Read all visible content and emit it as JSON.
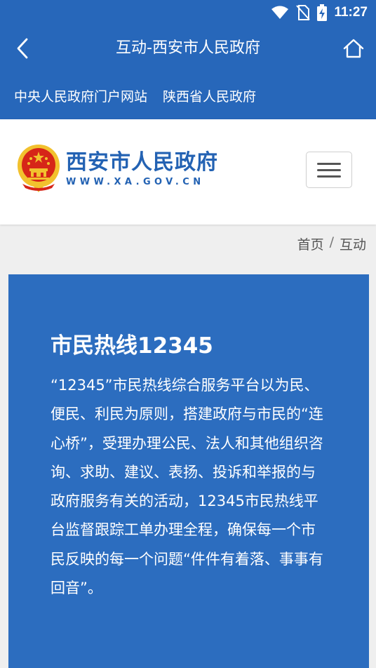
{
  "status_bar": {
    "time": "11:27",
    "icons": [
      "wifi-icon",
      "no-sim-icon",
      "battery-charging-icon"
    ]
  },
  "app_bar": {
    "title": "互动-西安市人民政府",
    "back_icon": "chevron-left-icon",
    "home_icon": "home-icon"
  },
  "top_links": [
    "中央人民政府门户网站",
    "陕西省人民政府"
  ],
  "site_header": {
    "logo_name": "西安市人民政府",
    "logo_url": "WWW.XA.GOV.CN",
    "menu_icon": "hamburger-menu-icon"
  },
  "breadcrumb": {
    "home": "首页",
    "separator": "/",
    "current": "互动"
  },
  "hotline_card": {
    "title": "市民热线12345",
    "body": "“12345”市民热线综合服务平台以为民、便民、利民为原则，搭建政府与市民的“连心桥”，受理办理公民、法人和其他组织咨询、求助、建议、表扬、投诉和举报的与政府服务有关的活动，12345市民热线平台监督跟踪工单办理全程，确保每一个市民反映的每一个问题“件件有着落、事事有回音”。"
  },
  "colors": {
    "primary": "#2767ba",
    "card": "#2c6dbf",
    "logo_blue": "#2362b3",
    "emblem_red": "#d62518",
    "emblem_gold": "#f2c12e"
  }
}
